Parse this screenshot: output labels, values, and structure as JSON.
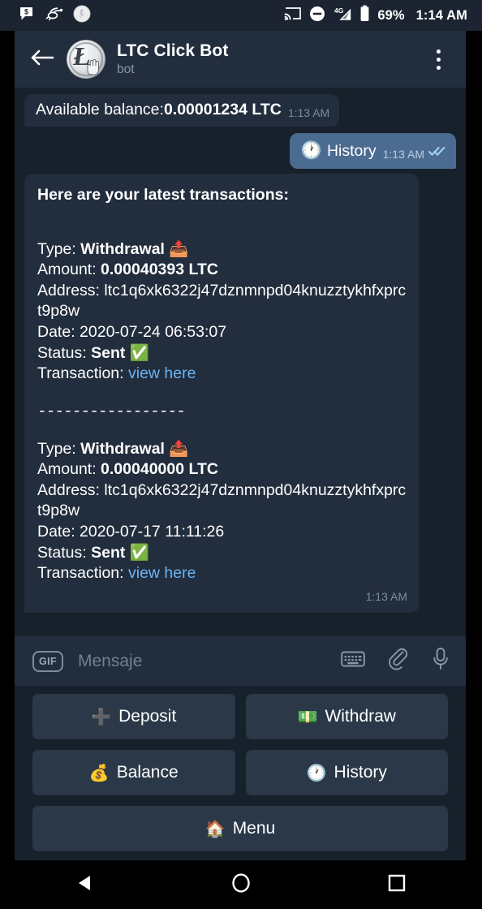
{
  "statusbar": {
    "icons_left": [
      "message-dollar-icon",
      "mosquito-icon",
      "circle-avatar-icon"
    ],
    "icons_right": [
      "cast-icon",
      "do-not-disturb-icon",
      "signal-4g-icon",
      "battery-icon"
    ],
    "battery_label": "69%",
    "clock": "1:14 AM"
  },
  "header": {
    "back_icon": "back-arrow-icon",
    "avatar_icon": "ltc-click-bot-avatar",
    "title": "LTC Click Bot",
    "subtitle": "bot",
    "overflow_icon": "more-vertical-icon"
  },
  "messages": {
    "balance": {
      "text_prefix": "Available balance: ",
      "amount": "0.00001234 LTC",
      "time": "1:13 AM"
    },
    "history_out": {
      "icon": "🕐",
      "label": "History",
      "time": "1:13 AM",
      "ticks": "double-check-icon"
    },
    "transactions": {
      "heading": "Here are your latest transactions:",
      "separator": "-----------------",
      "time": "1:13 AM",
      "labels": {
        "type": "Type: ",
        "amount": "Amount: ",
        "address": "Address: ",
        "date": "Date: ",
        "status": "Status: ",
        "transaction": "Transaction: "
      },
      "link_text": "view here",
      "items": [
        {
          "type": "Withdrawal",
          "type_emoji": "📤",
          "amount": "0.00040393 LTC",
          "address": "ltc1q6xk6322j47dznmnpd04knuzztykhfxprct9p8w",
          "date": "2020-07-24 06:53:07",
          "status": "Sent",
          "status_emoji": "✅"
        },
        {
          "type": "Withdrawal",
          "type_emoji": "📤",
          "amount": "0.00040000 LTC",
          "address": "ltc1q6xk6322j47dznmnpd04knuzztykhfxprct9p8w",
          "date": "2020-07-17 11:11:26",
          "status": "Sent",
          "status_emoji": "✅"
        }
      ]
    }
  },
  "input_bar": {
    "gif_label": "GIF",
    "placeholder": "Mensaje",
    "keyboard_icon": "keyboard-icon",
    "attach_icon": "paperclip-icon",
    "mic_icon": "microphone-icon"
  },
  "bot_keyboard": {
    "rows": [
      [
        {
          "icon": "➕",
          "label": "Deposit",
          "name": "deposit"
        },
        {
          "icon": "💵",
          "label": "Withdraw",
          "name": "withdraw"
        }
      ],
      [
        {
          "icon": "💰",
          "label": "Balance",
          "name": "balance"
        },
        {
          "icon": "🕐",
          "label": "History",
          "name": "history"
        }
      ],
      [
        {
          "icon": "🏠",
          "label": "Menu",
          "name": "menu"
        }
      ]
    ]
  },
  "navbar": {
    "back": "nav-back-icon",
    "home": "nav-home-icon",
    "recents": "nav-recents-icon"
  },
  "colors": {
    "chat_bg": "#17212b",
    "header_bg": "#222d3d",
    "bubble_in": "#222d3d",
    "bubble_out": "#4b6b91",
    "link": "#6ab3f3",
    "kb_button": "#2b3848"
  }
}
